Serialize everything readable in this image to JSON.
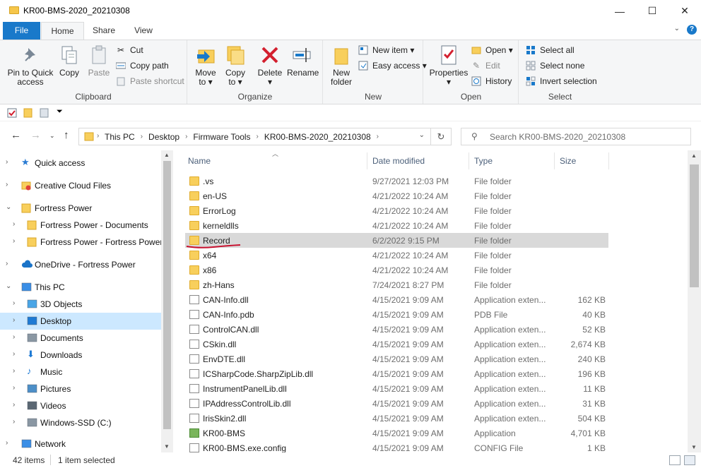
{
  "window": {
    "title": "KR00-BMS-2020_20210308",
    "minimize_glyph": "—",
    "maximize_glyph": "☐",
    "close_glyph": "✕"
  },
  "ribbon_tabs": {
    "file": "File",
    "home": "Home",
    "share": "Share",
    "view": "View"
  },
  "ribbon": {
    "clipboard": {
      "label": "Clipboard",
      "pin_line1": "Pin to Quick",
      "pin_line2": "access",
      "copy": "Copy",
      "paste": "Paste",
      "cut": "Cut",
      "copy_path": "Copy path",
      "paste_shortcut": "Paste shortcut"
    },
    "organize": {
      "label": "Organize",
      "move_to": "Move",
      "move_to2": "to",
      "copy_to": "Copy",
      "copy_to2": "to",
      "delete": "Delete",
      "rename": "Rename"
    },
    "new": {
      "label": "New",
      "new_folder1": "New",
      "new_folder2": "folder",
      "new_item": "New item",
      "easy_access": "Easy access"
    },
    "open": {
      "label": "Open",
      "properties": "Properties",
      "open": "Open",
      "edit": "Edit",
      "history": "History"
    },
    "select": {
      "label": "Select",
      "select_all": "Select all",
      "select_none": "Select none",
      "invert": "Invert selection"
    }
  },
  "address": {
    "crumbs": [
      "This PC",
      "Desktop",
      "Firmware Tools",
      "KR00-BMS-2020_20210308"
    ],
    "search_placeholder": "Search KR00-BMS-2020_20210308"
  },
  "nav": [
    {
      "label": "Quick access",
      "icon": "star-icon"
    },
    {
      "label": "Creative Cloud Files",
      "icon": "creative-cloud-icon"
    },
    {
      "label": "Fortress Power",
      "icon": "folder-icon"
    },
    {
      "label": "Fortress Power - Documents",
      "icon": "folder-icon"
    },
    {
      "label": "Fortress Power - Fortress Power C",
      "icon": "folder-icon"
    },
    {
      "label": "OneDrive - Fortress Power",
      "icon": "cloud-icon"
    },
    {
      "label": "This PC",
      "icon": "pc-icon"
    },
    {
      "label": "3D Objects",
      "icon": "cube-icon"
    },
    {
      "label": "Desktop",
      "icon": "desktop-icon"
    },
    {
      "label": "Documents",
      "icon": "documents-icon"
    },
    {
      "label": "Downloads",
      "icon": "download-icon"
    },
    {
      "label": "Music",
      "icon": "music-icon"
    },
    {
      "label": "Pictures",
      "icon": "pictures-icon"
    },
    {
      "label": "Videos",
      "icon": "videos-icon"
    },
    {
      "label": "Windows-SSD (C:)",
      "icon": "drive-icon"
    },
    {
      "label": "Network",
      "icon": "network-icon"
    }
  ],
  "columns": {
    "name": "Name",
    "date": "Date modified",
    "type": "Type",
    "size": "Size"
  },
  "files": [
    {
      "name": ".vs",
      "date": "9/27/2021 12:03 PM",
      "type": "File folder",
      "size": "",
      "kind": "folder"
    },
    {
      "name": "en-US",
      "date": "4/21/2022 10:24 AM",
      "type": "File folder",
      "size": "",
      "kind": "folder"
    },
    {
      "name": "ErrorLog",
      "date": "4/21/2022 10:24 AM",
      "type": "File folder",
      "size": "",
      "kind": "folder"
    },
    {
      "name": "kerneldlls",
      "date": "4/21/2022 10:24 AM",
      "type": "File folder",
      "size": "",
      "kind": "folder"
    },
    {
      "name": "Record",
      "date": "6/2/2022 9:15 PM",
      "type": "File folder",
      "size": "",
      "kind": "folder"
    },
    {
      "name": "x64",
      "date": "4/21/2022 10:24 AM",
      "type": "File folder",
      "size": "",
      "kind": "folder"
    },
    {
      "name": "x86",
      "date": "4/21/2022 10:24 AM",
      "type": "File folder",
      "size": "",
      "kind": "folder"
    },
    {
      "name": "zh-Hans",
      "date": "7/24/2021 8:27 PM",
      "type": "File folder",
      "size": "",
      "kind": "folder"
    },
    {
      "name": "CAN-Info.dll",
      "date": "4/15/2021 9:09 AM",
      "type": "Application exten...",
      "size": "162 KB",
      "kind": "doc"
    },
    {
      "name": "CAN-Info.pdb",
      "date": "4/15/2021 9:09 AM",
      "type": "PDB File",
      "size": "40 KB",
      "kind": "doc"
    },
    {
      "name": "ControlCAN.dll",
      "date": "4/15/2021 9:09 AM",
      "type": "Application exten...",
      "size": "52 KB",
      "kind": "doc"
    },
    {
      "name": "CSkin.dll",
      "date": "4/15/2021 9:09 AM",
      "type": "Application exten...",
      "size": "2,674 KB",
      "kind": "doc"
    },
    {
      "name": "EnvDTE.dll",
      "date": "4/15/2021 9:09 AM",
      "type": "Application exten...",
      "size": "240 KB",
      "kind": "doc"
    },
    {
      "name": "ICSharpCode.SharpZipLib.dll",
      "date": "4/15/2021 9:09 AM",
      "type": "Application exten...",
      "size": "196 KB",
      "kind": "doc"
    },
    {
      "name": "InstrumentPanelLib.dll",
      "date": "4/15/2021 9:09 AM",
      "type": "Application exten...",
      "size": "11 KB",
      "kind": "doc"
    },
    {
      "name": "IPAddressControlLib.dll",
      "date": "4/15/2021 9:09 AM",
      "type": "Application exten...",
      "size": "31 KB",
      "kind": "doc"
    },
    {
      "name": "IrisSkin2.dll",
      "date": "4/15/2021 9:09 AM",
      "type": "Application exten...",
      "size": "504 KB",
      "kind": "doc"
    },
    {
      "name": "KR00-BMS",
      "date": "4/15/2021 9:09 AM",
      "type": "Application",
      "size": "4,701 KB",
      "kind": "app"
    },
    {
      "name": "KR00-BMS.exe.config",
      "date": "4/15/2021 9:09 AM",
      "type": "CONFIG File",
      "size": "1 KB",
      "kind": "doc"
    }
  ],
  "status": {
    "count": "42 items",
    "selected": "1 item selected"
  },
  "colors": {
    "accent": "#1979ca",
    "selection": "#cce8ff",
    "row_selected": "#d9d9d9",
    "annotation": "#c8102e"
  }
}
